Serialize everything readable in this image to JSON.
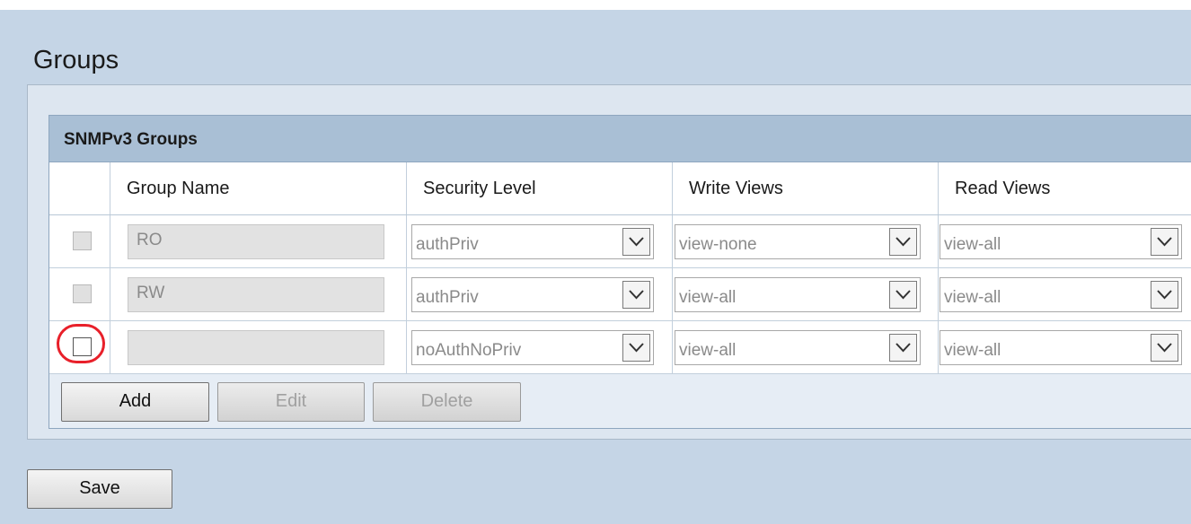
{
  "page": {
    "title": "Groups"
  },
  "panel": {
    "title": "SNMPv3 Groups",
    "columns": [
      "Group Name",
      "Security Level",
      "Write Views",
      "Read Views"
    ],
    "rows": [
      {
        "group_name": "RO",
        "security_level": "authPriv",
        "write_views": "view-none",
        "read_views": "view-all",
        "checkbox_enabled": false
      },
      {
        "group_name": "RW",
        "security_level": "authPriv",
        "write_views": "view-all",
        "read_views": "view-all",
        "checkbox_enabled": false
      },
      {
        "group_name": "",
        "security_level": "noAuthNoPriv",
        "write_views": "view-all",
        "read_views": "view-all",
        "checkbox_enabled": true
      }
    ],
    "buttons": {
      "add": "Add",
      "edit": "Edit",
      "delete": "Delete"
    }
  },
  "footer": {
    "save": "Save"
  },
  "colors": {
    "highlight_ring": "#e8202a",
    "page_background": "#c5d5e6",
    "panel_header": "#a9bfd5"
  }
}
